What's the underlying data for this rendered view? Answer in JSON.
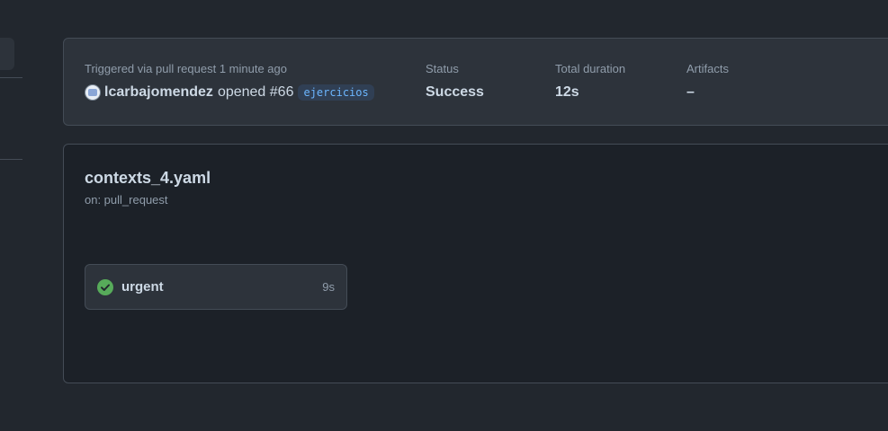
{
  "summary": {
    "trigger_text": "Triggered via pull request 1 minute ago",
    "actor": "lcarbajomendez",
    "action": "opened #66",
    "branch": "ejercicios",
    "status_label": "Status",
    "status_value": "Success",
    "duration_label": "Total duration",
    "duration_value": "12s",
    "artifacts_label": "Artifacts",
    "artifacts_value": "–"
  },
  "workflow": {
    "file": "contexts_4.yaml",
    "trigger": "on: pull_request",
    "jobs": [
      {
        "name": "urgent",
        "duration": "9s",
        "status": "success",
        "icon": "check-circle-icon"
      }
    ]
  },
  "colors": {
    "background": "#22272e",
    "card": "#2d333b",
    "graph_bg": "#1c2128",
    "border": "#444c56",
    "success": "#57ab5a",
    "branch_text": "#6cb6ff"
  }
}
